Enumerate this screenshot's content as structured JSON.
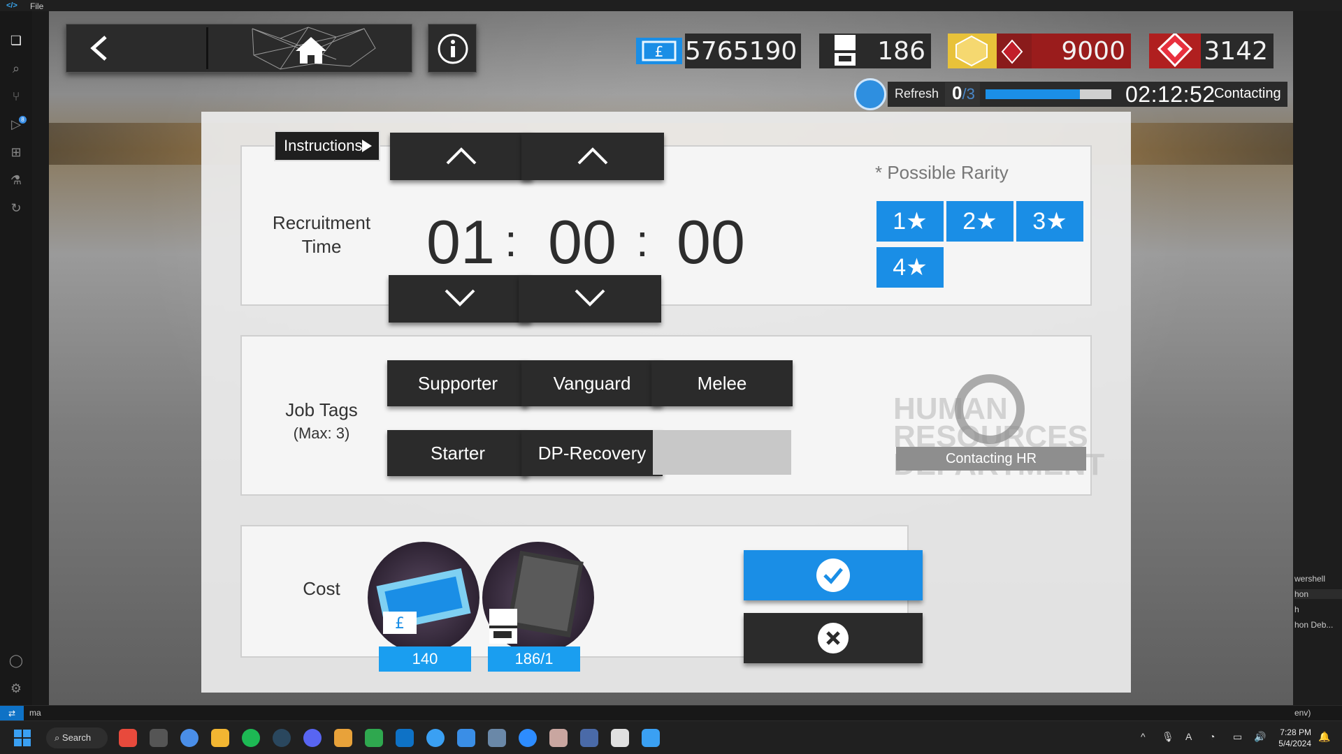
{
  "vscode": {
    "menu_file": "File",
    "right_panel": [
      "wershell",
      "hon",
      "h",
      "hon Deb..."
    ],
    "status_left": "ma",
    "status_right": "env)"
  },
  "game": {
    "resources": {
      "permits": "5765190",
      "slots": "186",
      "gold_orundum": "9000",
      "originium": "3142"
    },
    "refresh": {
      "label": "Refresh",
      "used": "0",
      "total": "/3",
      "progress": 0.75,
      "timer": "02:12:52",
      "status": "Contacting"
    },
    "instructions": "Instructions",
    "recruitment_time": {
      "label_line1": "Recruitment",
      "label_line2": "Time",
      "hours": "01",
      "minutes": "00",
      "seconds": "00",
      "sep": ":"
    },
    "rarity": {
      "title": "* Possible Rarity",
      "options": [
        "1★",
        "2★",
        "3★",
        "4★"
      ]
    },
    "job_tags": {
      "label": "Job Tags",
      "sublabel": "(Max: 3)",
      "tags": [
        "Supporter",
        "Vanguard",
        "Melee",
        "Starter",
        "DP-Recovery"
      ],
      "watermark": "HUMAN RESOURCES DEPARTMENT",
      "hr_button": "Contacting HR"
    },
    "cost": {
      "label": "Cost",
      "permit_cost": "140",
      "slot_cost": "186/1"
    }
  },
  "taskbar": {
    "search": "Search",
    "time": "7:28 PM",
    "date": "5/4/2024"
  },
  "colors": {
    "accent_blue": "#1a8ee6",
    "dark_button": "#2b2b2b"
  }
}
